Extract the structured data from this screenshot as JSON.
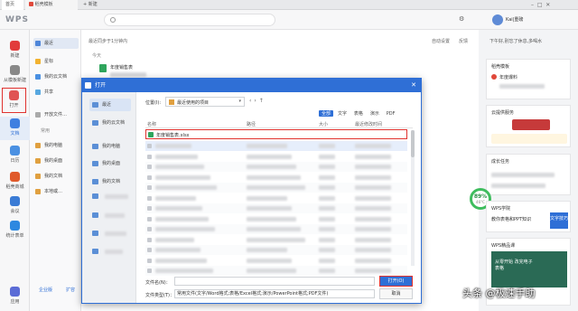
{
  "tabs": {
    "home": "首页",
    "template": "稻壳模板",
    "new": "新建"
  },
  "header": {
    "user": "Kai|重磅"
  },
  "leftnav": [
    {
      "label": "新建",
      "color": "#e23b3b"
    },
    {
      "label": "从模板新建",
      "color": "#888888"
    },
    {
      "label": "打开",
      "color": "#e05353"
    },
    {
      "label": "文档",
      "color": "#3f7fe0"
    },
    {
      "label": "日历",
      "color": "#4a90e2"
    },
    {
      "label": "稻壳商城",
      "color": "#e05a2b"
    },
    {
      "label": "会议",
      "color": "#3a7bd5"
    },
    {
      "label": "统计表单",
      "color": "#2d88e0"
    },
    {
      "label": "应用",
      "color": "#5b6cd6"
    }
  ],
  "sidebar": {
    "items": [
      "最近",
      "星标",
      "我的云文档",
      "共享",
      "开放文件…"
    ],
    "section_label": "常用",
    "common": [
      "我的电脑",
      "我的桌面",
      "我的文档",
      "本地或…"
    ],
    "bottom_left": "企业版",
    "bottom_right": "扩容"
  },
  "main": {
    "sync_note": "最近同步于1分钟内",
    "group": "今天",
    "file1": "年度销售表",
    "toolbar_a": "自动设置",
    "toolbar_b": "反馈"
  },
  "dialog": {
    "title": "打开",
    "location_label": "位置(I):",
    "location_value": "最近使用的项目",
    "side_items": [
      "最近",
      "我的云文档",
      "我的电脑",
      "我的桌面",
      "我的文档"
    ],
    "filters": [
      "全部",
      "文字",
      "表格",
      "演示",
      "PDF"
    ],
    "columns": [
      "名称",
      "路径",
      "大小",
      "最近修改时间"
    ],
    "selected_file": "年度销售表.xlsx",
    "filename_label": "文件名(N)：",
    "filetype_label": "文件类型(T)：",
    "filetype_value": "常用文件(文字/Word格式;表格/Excel格式;演示/PowerPoint格式;PDF文件)",
    "open_button": "打开(O)",
    "cancel_button": "取消"
  },
  "rightpanel": {
    "top": "下午好,别忘了休息,多喝水",
    "card1_title": "稻壳模板",
    "card1_text": "年度爆料",
    "card2_title": "云提供服务",
    "card3_title": "成长任务",
    "gauge_value": "89%",
    "gauge_sub": "46°C",
    "card4_title": "WPS学院",
    "card4_text": "教你表格和PPT知识",
    "card4_badge": "文字技巧",
    "card5_title": "WPS精品课",
    "card5_text": "从零开始 改完电子表格"
  },
  "watermark": "头条 @极速手助"
}
